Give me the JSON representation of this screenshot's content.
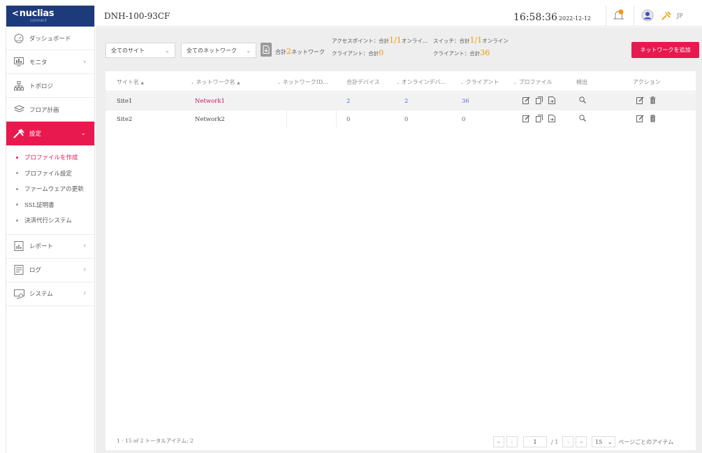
{
  "brand": {
    "name": "nuclias",
    "sub": "connect"
  },
  "topbar": {
    "device": "DNH-100-93CF",
    "time": "16:58:36",
    "date": "2022-12-12",
    "lang": "JP"
  },
  "sidebar": {
    "items": [
      {
        "label": "ダッシュボード",
        "icon": "dashboard-icon"
      },
      {
        "label": "モニタ",
        "icon": "monitor-icon",
        "arrow": "›"
      },
      {
        "label": "トポロジ",
        "icon": "topology-icon"
      },
      {
        "label": "フロア計画",
        "icon": "floorplan-icon"
      },
      {
        "label": "設定",
        "icon": "settings-icon",
        "arrow": "⌄"
      },
      {
        "label": "レポート",
        "icon": "report-icon",
        "arrow": "›"
      },
      {
        "label": "ログ",
        "icon": "log-icon",
        "arrow": "›"
      },
      {
        "label": "システム",
        "icon": "system-icon",
        "arrow": "›"
      }
    ],
    "submenu": [
      "プロファイルを作成",
      "プロファイル設定",
      "ファームウェアの更新",
      "SSL証明書",
      "決済代行システム"
    ]
  },
  "toolbar": {
    "site_select": "全てのサイト",
    "network_select": "全てのネットワーク",
    "total_prefix": "合計",
    "total_networks": "2",
    "total_suffix": "ネットワーク",
    "ap_label": "アクセスポイント：合計",
    "ap_value": "1/1",
    "ap_suffix": "オンライ...",
    "sw_label": "スイッチ：合計",
    "sw_value": "1/1",
    "sw_suffix": "オンライン",
    "client1_label": "クライアント：合計",
    "client1_value": "0",
    "client2_label": "クライアント：合計",
    "client2_value": "36",
    "add_button": "ネットワークを追加"
  },
  "table": {
    "headers": {
      "site": "サイト名",
      "network": "ネットワーク名",
      "network_id": "ネットワークID...",
      "total_devices": "合計デバイス",
      "online_devices": "オンラインデバ...",
      "clients": "クライアント",
      "profile": "プロファイル",
      "detect": "検出",
      "action": "アクション"
    },
    "rows": [
      {
        "site": "Site1",
        "network": "Network1",
        "network_id": "",
        "total_devices": "2",
        "online_devices": "2",
        "clients": "36"
      },
      {
        "site": "Site2",
        "network": "Network2",
        "network_id": "",
        "total_devices": "0",
        "online_devices": "0",
        "clients": "0"
      }
    ]
  },
  "footer": {
    "summary": "1 - 15 of 2  トータルアイテム: 2",
    "page_input": "1",
    "page_total": "/ 1",
    "per_page": "15",
    "per_page_label": "ページごとのアイテム"
  },
  "colors": {
    "accent": "#e8194e",
    "brand": "#1d3a7a",
    "highlight": "#f39800",
    "link": "#c2185b",
    "count": "#5a6fd6"
  }
}
